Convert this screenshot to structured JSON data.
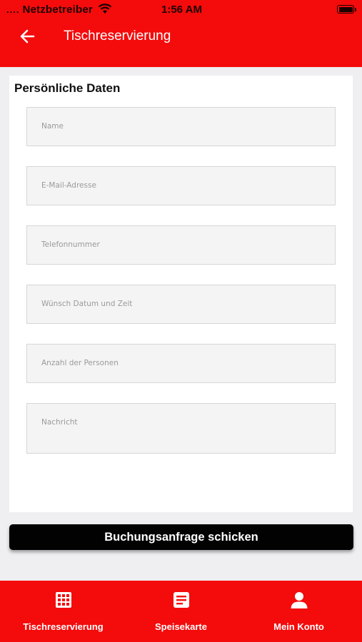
{
  "status_bar": {
    "signal": "....",
    "carrier": "Netzbetreiber",
    "time": "1:56 AM"
  },
  "header": {
    "title": "Tischreservierung",
    "back_icon": "arrow-left-icon"
  },
  "form": {
    "section_title": "Persönliche Daten",
    "fields": [
      {
        "placeholder": "Name"
      },
      {
        "placeholder": "E-Mail-Adresse"
      },
      {
        "placeholder": "Telefonnummer"
      },
      {
        "placeholder": "Wünsch Datum und Zeit"
      },
      {
        "placeholder": "Anzahl der Personen"
      },
      {
        "placeholder": "Nachricht"
      }
    ],
    "submit_label": "Buchungsanfrage schicken"
  },
  "tabs": [
    {
      "label": "Tischreservierung",
      "icon": "grid-icon"
    },
    {
      "label": "Speisekarte",
      "icon": "menu-document-icon"
    },
    {
      "label": "Mein Konto",
      "icon": "person-icon"
    }
  ],
  "colors": {
    "accent": "#f40b0b",
    "button": "#020202",
    "background": "#efeff2"
  }
}
